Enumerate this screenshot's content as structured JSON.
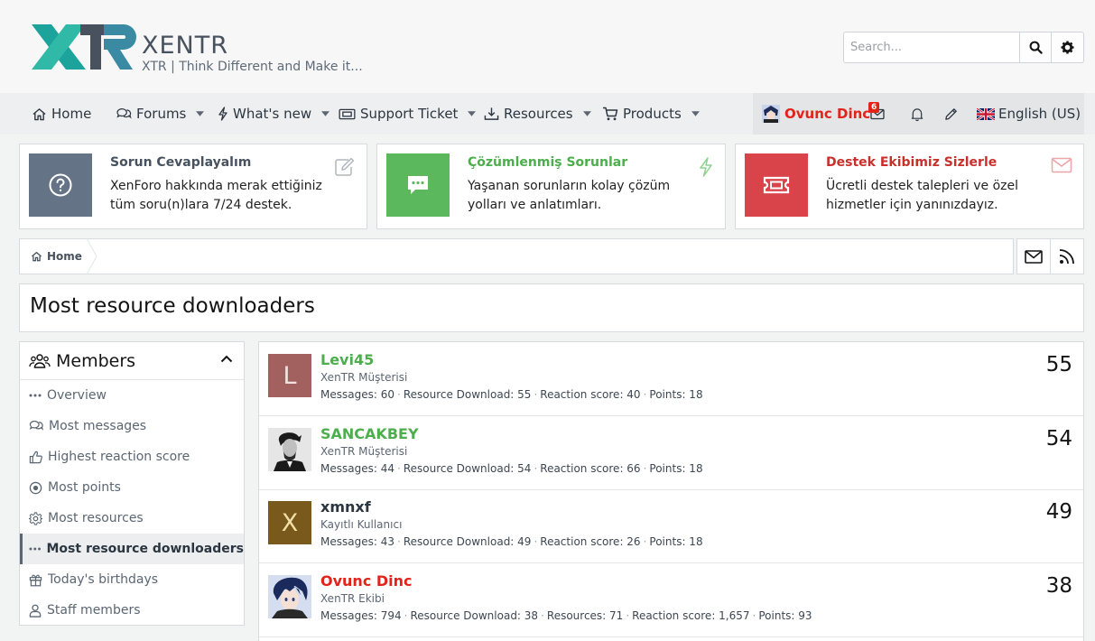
{
  "header": {
    "logo_mark": "XTR",
    "logo_title": "XENTR",
    "logo_subtitle": "XTR | Think Different and Make it...",
    "search_placeholder": "Search..."
  },
  "nav": {
    "items": [
      {
        "label": "Home",
        "icon": "home-icon",
        "dropdown": false
      },
      {
        "label": "Forums",
        "icon": "comments-icon",
        "dropdown": true
      },
      {
        "label": "What's new",
        "icon": "bolt-icon",
        "dropdown": true
      },
      {
        "label": "Support Ticket",
        "icon": "ticket-icon",
        "dropdown": true
      },
      {
        "label": "Resources",
        "icon": "download-icon",
        "dropdown": true
      },
      {
        "label": "Products",
        "icon": "cart-icon",
        "dropdown": true
      }
    ],
    "user": {
      "name": "Ovunc Dinc",
      "inbox_badge": "6",
      "language": "English (US)"
    }
  },
  "notices": [
    {
      "title": "Sorun Cevaplayalım",
      "text": "XenForo hakkında merak ettiğiniz tüm soru(n)lara 7/24 destek.",
      "color": "#647386",
      "title_color": "#47525e",
      "icon": "question-circle-icon",
      "corner_icon": "edit-icon"
    },
    {
      "title": "Çözümlenmiş Sorunlar",
      "text": "Yaşanan sorunların kolay çözüm yolları ve anlatımları.",
      "color": "#5cb85c",
      "title_color": "#4cae4c",
      "icon": "comment-dots-icon",
      "corner_icon": "bolt-icon"
    },
    {
      "title": "Destek Ekibimiz Sizlerle",
      "text": "Ücretli destek talepleri ve özel hizmetler için yanınızdayız.",
      "color": "#d9444a",
      "title_color": "#c9302c",
      "icon": "ticket-icon",
      "corner_icon": "envelope-icon"
    }
  ],
  "breadcrumb": {
    "home": "Home"
  },
  "page_title": "Most resource downloaders",
  "sidebar": {
    "title": "Members",
    "items": [
      {
        "label": "Overview",
        "icon": "dots-icon",
        "active": false
      },
      {
        "label": "Most messages",
        "icon": "comments-icon",
        "active": false
      },
      {
        "label": "Highest reaction score",
        "icon": "thumbs-up-icon",
        "active": false
      },
      {
        "label": "Most points",
        "icon": "dot-circle-icon",
        "active": false
      },
      {
        "label": "Most resources",
        "icon": "cog-icon",
        "active": false
      },
      {
        "label": "Most resource downloaders",
        "icon": "dots-icon",
        "active": true
      },
      {
        "label": "Today's birthdays",
        "icon": "gift-icon",
        "active": false
      },
      {
        "label": "Staff members",
        "icon": "user-icon",
        "active": false
      }
    ]
  },
  "members": [
    {
      "name": "Levi45",
      "name_color": "#4cae4c",
      "avatar_letter": "L",
      "avatar_color": "#a2615f",
      "title": "XenTR Müşterisi",
      "stats": [
        "Messages: 60",
        "Resource Download: 55",
        "Reaction score: 40",
        "Points: 18"
      ],
      "count": "55"
    },
    {
      "name": "SANCAKBEY",
      "name_color": "#4cae4c",
      "avatar_letter": "",
      "avatar_color": "#dcdcdc",
      "title": "XenTR Müşterisi",
      "stats": [
        "Messages: 44",
        "Resource Download: 54",
        "Reaction score: 66",
        "Points: 18"
      ],
      "count": "54"
    },
    {
      "name": "xmnxf",
      "name_color": "#2c3640",
      "avatar_letter": "X",
      "avatar_color": "#7a5a1c",
      "title": "Kayıtlı Kullanıcı",
      "stats": [
        "Messages: 43",
        "Resource Download: 49",
        "Reaction score: 26",
        "Points: 18"
      ],
      "count": "49"
    },
    {
      "name": "Ovunc Dinc",
      "name_color": "#e2231a",
      "avatar_letter": "",
      "avatar_color": "#2d4a8a",
      "title": "XenTR Ekibi",
      "stats": [
        "Messages: 794",
        "Resource Download: 38",
        "Resources: 71",
        "Reaction score: 1,657",
        "Points: 93"
      ],
      "count": "38"
    }
  ]
}
